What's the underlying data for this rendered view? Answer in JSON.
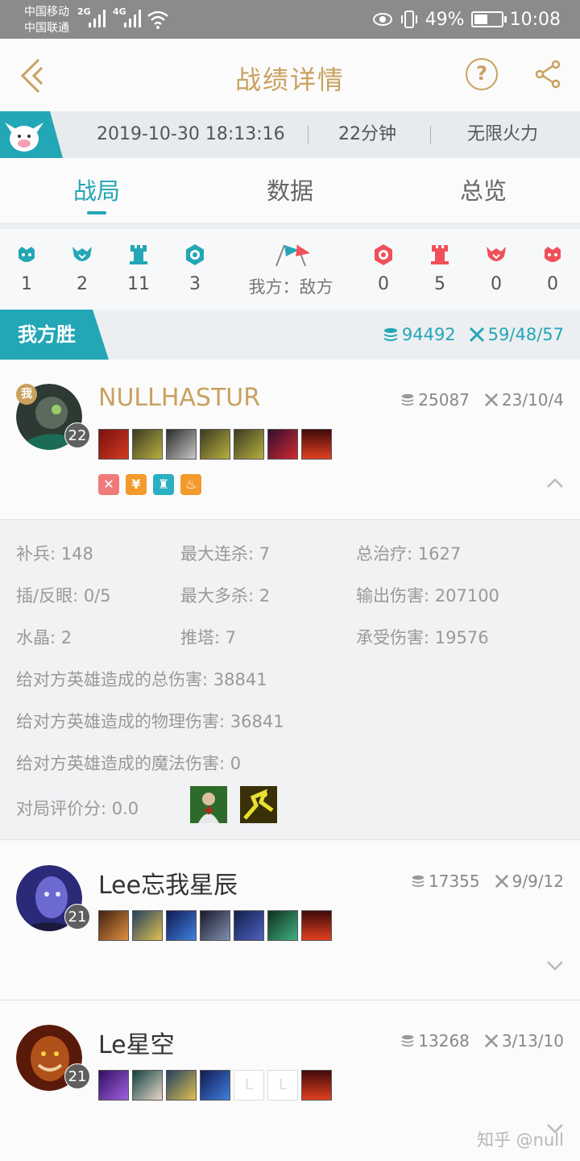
{
  "status_bar": {
    "carrier1": "中国移动",
    "carrier2": "中国联通",
    "net1": "2G",
    "net2": "4G",
    "battery": "49%",
    "time": "10:08"
  },
  "header": {
    "title": "战绩详情"
  },
  "match_info": {
    "datetime": "2019-10-30 18:13:16",
    "duration": "22分钟",
    "mode": "无限火力"
  },
  "tabs": [
    "战局",
    "数据",
    "总览"
  ],
  "objectives": {
    "ally": [
      "1",
      "2",
      "11",
      "3"
    ],
    "enemy": [
      "0",
      "5",
      "0",
      "0"
    ],
    "label": "我方：敌方"
  },
  "result": {
    "label": "我方胜",
    "gold": "94492",
    "kda": "59/48/57"
  },
  "players": [
    {
      "name": "NULLHASTUR",
      "level": "22",
      "gold": "25087",
      "kda": "23/10/4",
      "self_badge": "我",
      "badges": [
        "✕",
        "¥",
        "♜",
        "♨"
      ],
      "details": {
        "cs": "补兵: 148",
        "max_streak": "最大连杀: 7",
        "total_heal": "总治疗: 1627",
        "wards": "插/反眼: 0/5",
        "max_multi": "最大多杀: 2",
        "damage_out": "输出伤害: 207100",
        "inhib": "水晶: 2",
        "towers": "推塔: 7",
        "damage_taken": "承受伤害: 19576",
        "champ_total": "给对方英雄造成的总伤害: 38841",
        "champ_physical": "给对方英雄造成的物理伤害: 36841",
        "champ_magic": "给对方英雄造成的魔法伤害: 0",
        "score": "对局评价分: 0.0"
      }
    },
    {
      "name": "Lee忘我星辰",
      "level": "21",
      "gold": "17355",
      "kda": "9/9/12"
    },
    {
      "name": "Le星空",
      "level": "21",
      "gold": "13268",
      "kda": "3/13/10"
    }
  ],
  "watermark": "知乎 @null",
  "colors": {
    "accent": "#23a6b6",
    "gold": "#c9a15f",
    "enemy": "#f0505a"
  }
}
